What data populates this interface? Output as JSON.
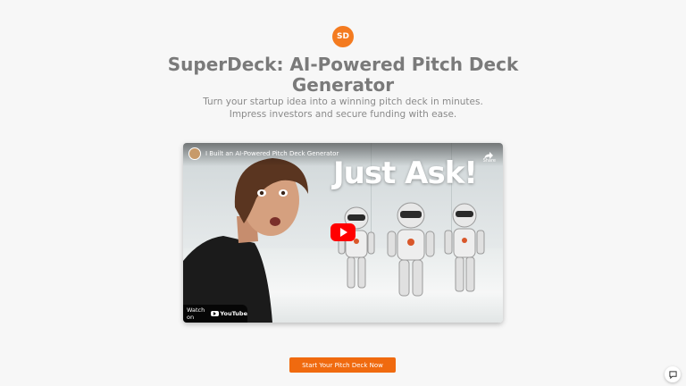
{
  "logo": {
    "text": "SD",
    "color": "#f47b20"
  },
  "hero": {
    "title": "SuperDeck: AI-Powered Pitch Deck Generator",
    "subtitle_line1": "Turn your startup idea into a winning pitch deck in minutes.",
    "subtitle_line2": "Impress investors and secure funding with ease."
  },
  "video": {
    "title": "I Built an AI-Powered Pitch Deck Generator",
    "share_label": "Share",
    "overlay_text": "Just Ask!",
    "watch_on": "Watch on",
    "provider": "YouTube",
    "icons": [
      "channel-avatar",
      "share-icon",
      "play-icon",
      "youtube-icon"
    ]
  },
  "cta": {
    "label": "Start Your Pitch Deck Now",
    "color": "#f06a0f"
  },
  "chat": {
    "icon": "chat-icon"
  }
}
